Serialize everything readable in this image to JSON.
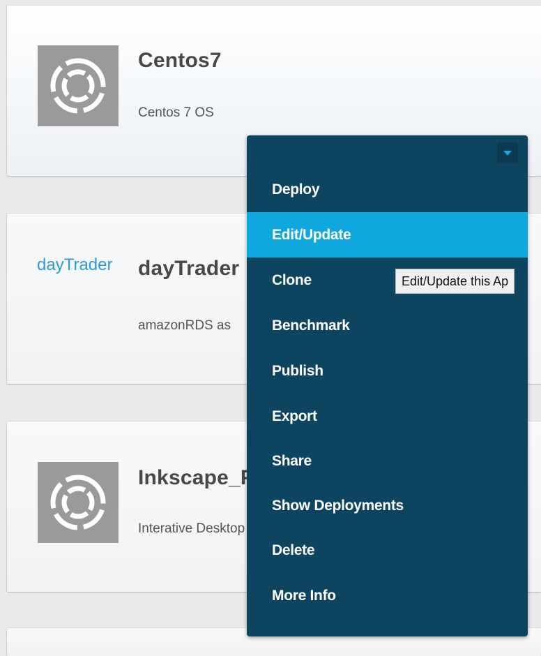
{
  "apps": [
    {
      "icon": "app-placeholder-icon",
      "title": "Centos7",
      "description": "Centos 7 OS"
    },
    {
      "logo_text": "dayTrader",
      "title": "dayTrader",
      "description": "amazonRDS as"
    },
    {
      "icon": "app-placeholder-icon",
      "title": "Inkscape_Projects_UI",
      "description": "Interative Desktop App - For Ubuntu O..."
    }
  ],
  "menu": {
    "toggle_icon": "caret-down-icon",
    "items": [
      "Deploy",
      "Edit/Update",
      "Clone",
      "Benchmark",
      "Publish",
      "Export",
      "Share",
      "Show Deployments",
      "Delete",
      "More Info"
    ],
    "active_index": 1
  },
  "tooltip": {
    "text": "Edit/Update this Ap"
  },
  "colors": {
    "menu_bg": "#0d4560",
    "menu_active": "#10a7df",
    "brand_blue": "#2e9cd4",
    "icon_gray": "#9a9a9a"
  }
}
